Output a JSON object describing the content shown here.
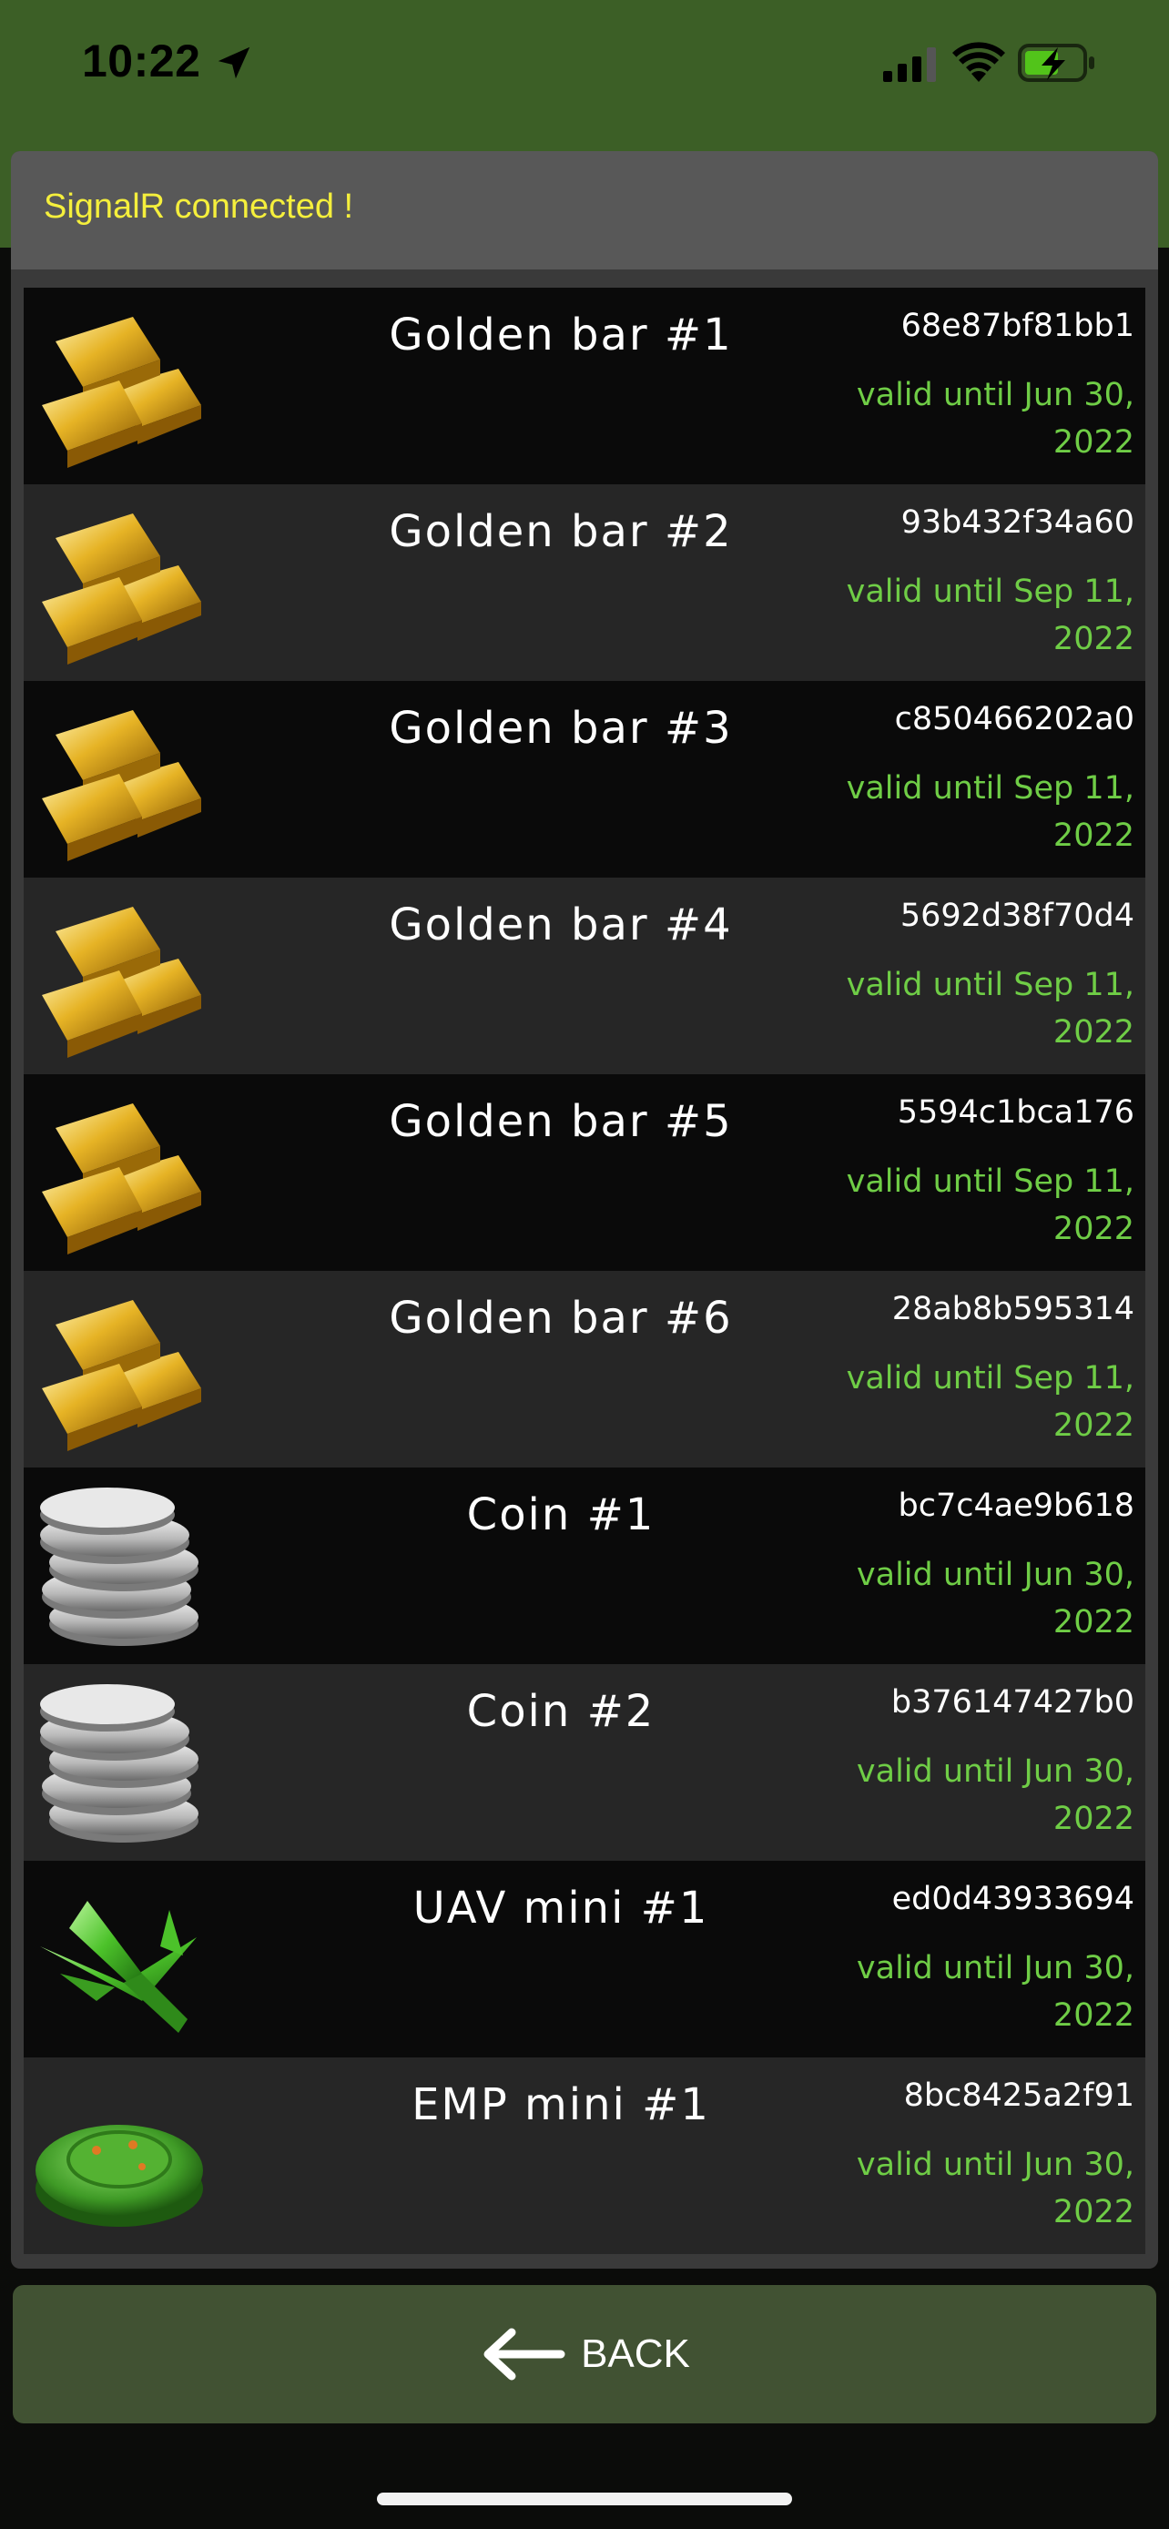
{
  "status_bar": {
    "time": "10:22",
    "icons": [
      "location-arrow-icon",
      "cellular-signal-icon",
      "wifi-icon",
      "battery-charging-icon"
    ]
  },
  "banner": {
    "text": "SignalR connected !",
    "color": "#f5ef3c"
  },
  "items": [
    {
      "name": "Golden bar #1",
      "code": "68e87bf81bb1",
      "valid": "valid until Jun 30, 2022",
      "icon": "gold-bar-icon"
    },
    {
      "name": "Golden bar #2",
      "code": "93b432f34a60",
      "valid": "valid until Sep 11, 2022",
      "icon": "gold-bar-icon"
    },
    {
      "name": "Golden bar #3",
      "code": "c850466202a0",
      "valid": "valid until Sep 11, 2022",
      "icon": "gold-bar-icon"
    },
    {
      "name": "Golden bar #4",
      "code": "5692d38f70d4",
      "valid": "valid until Sep 11, 2022",
      "icon": "gold-bar-icon"
    },
    {
      "name": "Golden bar #5",
      "code": "5594c1bca176",
      "valid": "valid until Sep 11, 2022",
      "icon": "gold-bar-icon"
    },
    {
      "name": "Golden bar #6",
      "code": "28ab8b595314",
      "valid": "valid until Sep 11, 2022",
      "icon": "gold-bar-icon"
    },
    {
      "name": "Coin #1",
      "code": "bc7c4ae9b618",
      "valid": "valid until Jun 30, 2022",
      "icon": "silver-coins-icon"
    },
    {
      "name": "Coin #2",
      "code": "b376147427b0",
      "valid": "valid until Jun 30, 2022",
      "icon": "silver-coins-icon"
    },
    {
      "name": "UAV mini #1",
      "code": "ed0d43933694",
      "valid": "valid until Jun 30, 2022",
      "icon": "green-jet-icon"
    },
    {
      "name": "EMP mini #1",
      "code": "8bc8425a2f91",
      "valid": "valid until Jun 30, 2022",
      "icon": "green-emp-device-icon"
    }
  ],
  "back_button": {
    "label": "BACK",
    "icon": "arrow-left-icon"
  },
  "colors": {
    "header": "#3c5f26",
    "valid_text": "#6fcd46",
    "row_dark": "#0a0a0a",
    "row_light": "#262626",
    "button": "#415233"
  }
}
